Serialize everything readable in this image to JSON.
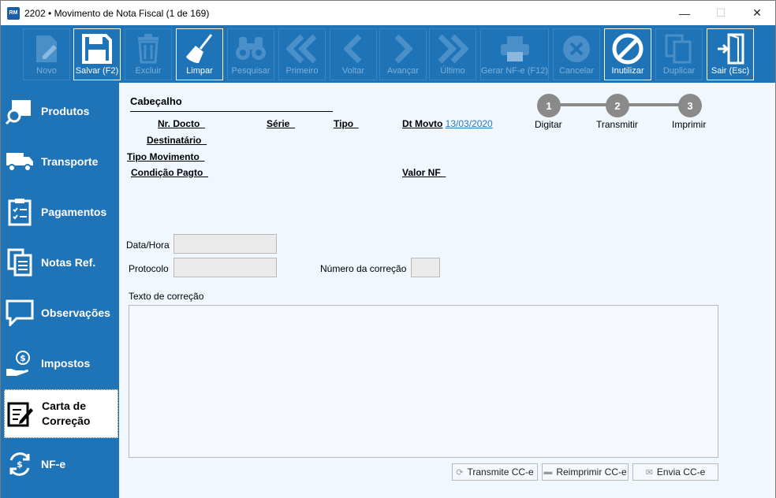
{
  "window": {
    "title": "2202 • Movimento de Nota Fiscal (1 de 169)",
    "app_icon_text": "RM",
    "minimize": "—",
    "maximize": "☐",
    "close": "✕"
  },
  "toolbar": {
    "novo": "Novo",
    "salvar": "Salvar (F2)",
    "excluir": "Excluir",
    "limpar": "Limpar",
    "pesquisar": "Pesquisar",
    "primeiro": "Primeiro",
    "voltar": "Voltar",
    "avancar": "Avançar",
    "ultimo": "Último",
    "gerar_nfe": "Gerar NF-e (F12)",
    "cancelar": "Cancelar",
    "inutilizar": "Inutilizar",
    "duplicar": "Duplicar",
    "sair": "Sair (Esc)"
  },
  "sidebar": {
    "produtos": "Produtos",
    "transporte": "Transporte",
    "pagamentos": "Pagamentos",
    "notas_ref": "Notas Ref.",
    "observacoes": "Observações",
    "impostos": "Impostos",
    "carta_line1": "Carta de",
    "carta_line2": "Correção",
    "nfe": "NF-e"
  },
  "header": {
    "title": "Cabeçalho",
    "nr_docto": "Nr. Docto  ",
    "serie": "Série  ",
    "tipo": "Tipo  ",
    "dt_movto": "Dt Movto",
    "dt_movto_value": "13/03/2020",
    "destinatario": "Destinatário  ",
    "tipo_movimento": "Tipo Movimento  ",
    "condicao_pagto": "Condição Pagto  ",
    "valor_nf": "Valor NF  "
  },
  "steps": [
    {
      "num": "1",
      "label": "Digitar"
    },
    {
      "num": "2",
      "label": "Transmitir"
    },
    {
      "num": "3",
      "label": "Imprimir"
    }
  ],
  "form": {
    "data_hora": "Data/Hora",
    "protocolo": "Protocolo",
    "numero_correcao": "Número da correção",
    "texto_correcao": "Texto de correção"
  },
  "actions": {
    "transmite": "Transmite CC-e",
    "reimprimir": "Reimprimir CC-e",
    "envia": "Envia CC-e"
  },
  "colors": {
    "primary": "#1f73b7",
    "content_bg": "#f0f7ff",
    "step_gray": "#8a8a8a",
    "date_link": "#2b78b8"
  }
}
